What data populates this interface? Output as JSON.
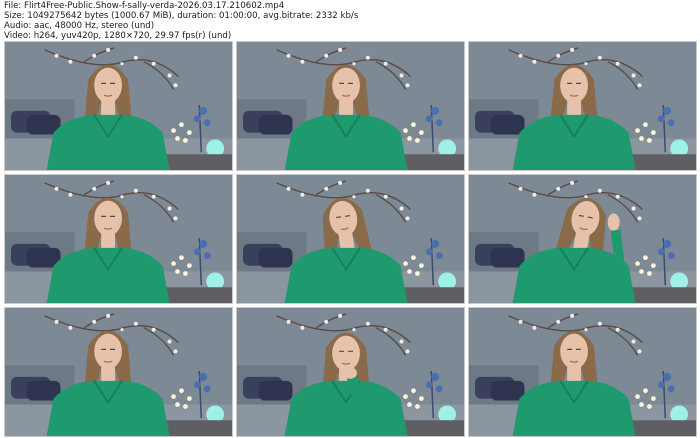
{
  "header": {
    "file_line": "File: Flirt4Free-Public.Show-f-sally-verda-2026.03.17.210602.mp4",
    "size_line": "Size: 1049275642 bytes (1000.67 MiB), duration: 01:00:00, avg.bitrate: 2332 kb/s",
    "audio_line": "Audio: aac, 48000 Hz, stereo (und)",
    "video_line": "Video: h264, yuv420p, 1280×720, 29.97 fps(r) (und)"
  },
  "thumbnails": [
    {
      "pose": "down"
    },
    {
      "pose": "down"
    },
    {
      "pose": "down"
    },
    {
      "pose": "down"
    },
    {
      "pose": "tilt"
    },
    {
      "pose": "hair"
    },
    {
      "pose": "down"
    },
    {
      "pose": "chin"
    },
    {
      "pose": "down"
    }
  ],
  "colors": {
    "wall": "#7d8a96",
    "shirt": "#1f9a6e",
    "hair": "#8a6a48",
    "skin": "#e6c2aa",
    "lamp": "#9ff0e6"
  }
}
